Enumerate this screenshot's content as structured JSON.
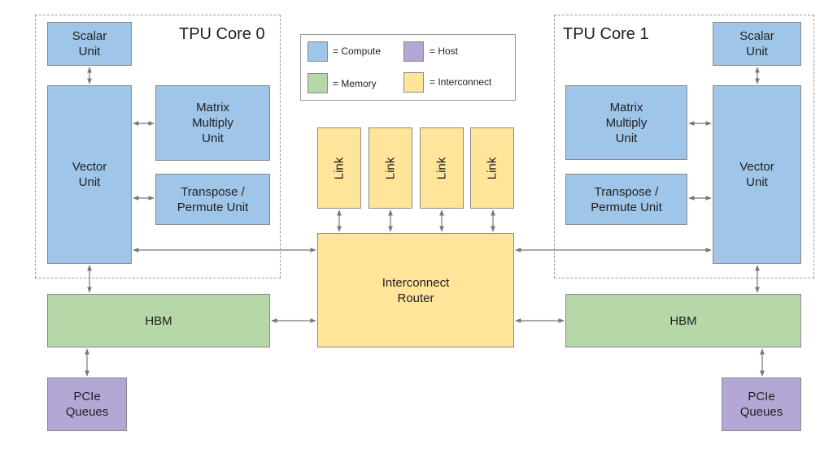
{
  "legend": {
    "items": [
      {
        "label": "= Compute",
        "color": "#9fc5e8"
      },
      {
        "label": "= Host",
        "color": "#b4a7d6"
      },
      {
        "label": "= Memory",
        "color": "#b6d7a8"
      },
      {
        "label": "= Interconnect",
        "color": "#ffe599"
      }
    ]
  },
  "core0": {
    "title": "TPU Core 0",
    "scalar": "Scalar\nUnit",
    "vector": "Vector\nUnit",
    "matrix": "Matrix\nMultiply\nUnit",
    "transpose": "Transpose /\nPermute Unit"
  },
  "core1": {
    "title": "TPU Core 1",
    "scalar": "Scalar\nUnit",
    "vector": "Vector\nUnit",
    "matrix": "Matrix\nMultiply\nUnit",
    "transpose": "Transpose /\nPermute Unit"
  },
  "links": [
    "Link",
    "Link",
    "Link",
    "Link"
  ],
  "router": "Interconnect\nRouter",
  "hbm_left": "HBM",
  "hbm_right": "HBM",
  "pcie_left": "PCIe\nQueues",
  "pcie_right": "PCIe\nQueues",
  "colors": {
    "compute": "#9fc5e8",
    "memory": "#b6d7a8",
    "host": "#b4a7d6",
    "interconnect": "#ffe599",
    "arrow": "#777777"
  }
}
